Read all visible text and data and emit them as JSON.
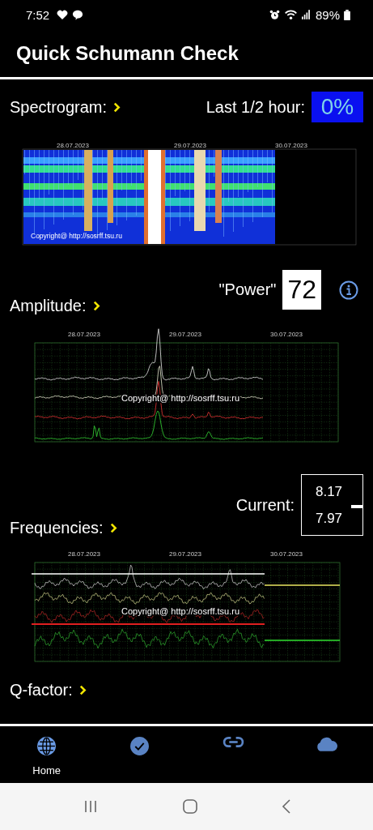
{
  "status_bar": {
    "time": "7:52",
    "battery": "89%"
  },
  "app_bar": {
    "title": "Quick Schumann Check"
  },
  "spectrogram": {
    "label": "Spectrogram:",
    "last_label": "Last 1/2 hour:",
    "last_value": "0%"
  },
  "spectrogram_chart": {
    "dates": [
      "28.07.2023",
      "29.07.2023",
      "30.07.2023"
    ],
    "copyright": "Copyright@ http://sosrff.tsu.ru"
  },
  "amplitude": {
    "label": "Amplitude:",
    "power_label": "\"Power\"",
    "power_value": "72"
  },
  "amplitude_chart": {
    "dates": [
      "28.07.2023",
      "29.07.2023",
      "30.07.2023"
    ],
    "copyright": "Copyright@ http://sosrff.tsu.ru"
  },
  "frequencies": {
    "label": "Frequencies:",
    "current_label": "Current:",
    "current_values": [
      "8.17",
      "7.97"
    ]
  },
  "frequencies_chart": {
    "dates": [
      "28.07.2023",
      "29.07.2023",
      "30.07.2023"
    ],
    "copyright": "Copyright@ http://sosrff.tsu.ru"
  },
  "q_factor": {
    "label": "Q-factor:"
  },
  "bottom_nav": [
    {
      "kind": "globe",
      "label": "Home",
      "selected": true
    },
    {
      "kind": "check",
      "selected": false
    },
    {
      "kind": "link",
      "selected": false
    },
    {
      "kind": "cloud",
      "selected": false
    }
  ]
}
